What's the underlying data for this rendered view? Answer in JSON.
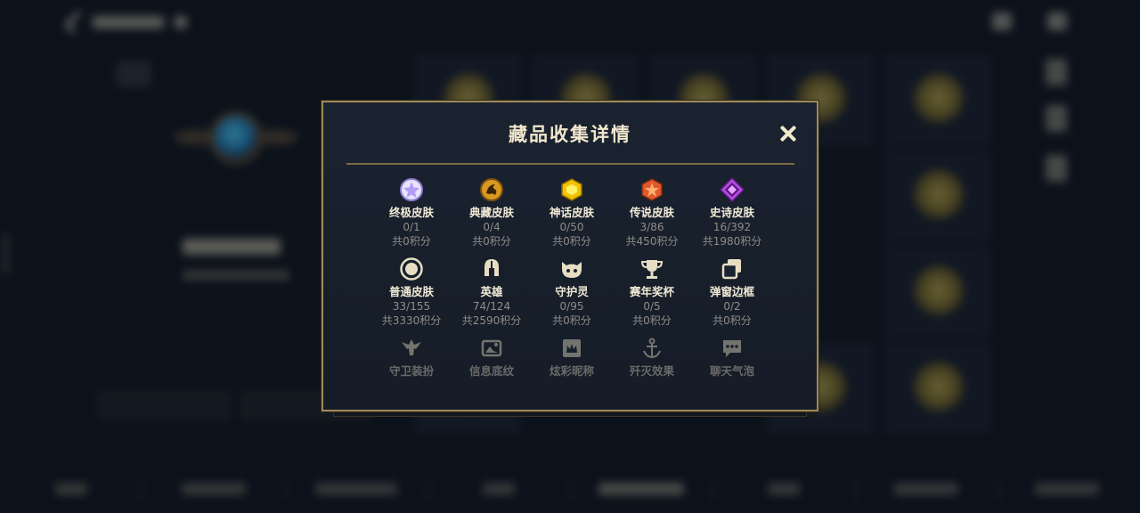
{
  "modal": {
    "title": "藏品收集详情",
    "close_label": "×"
  },
  "collections": [
    {
      "name": "终极皮肤",
      "count": "0/1",
      "score": "共0积分",
      "icon": "ultimate-skin-icon"
    },
    {
      "name": "典藏皮肤",
      "count": "0/4",
      "score": "共0积分",
      "icon": "collector-skin-icon"
    },
    {
      "name": "神话皮肤",
      "count": "0/50",
      "score": "共0积分",
      "icon": "mythic-skin-icon"
    },
    {
      "name": "传说皮肤",
      "count": "3/86",
      "score": "共450积分",
      "icon": "legend-skin-icon"
    },
    {
      "name": "史诗皮肤",
      "count": "16/392",
      "score": "共1980积分",
      "icon": "epic-skin-icon"
    },
    {
      "name": "普通皮肤",
      "count": "33/155",
      "score": "共3330积分",
      "icon": "common-skin-icon"
    },
    {
      "name": "英雄",
      "count": "74/124",
      "score": "共2590积分",
      "icon": "hero-helmet-icon"
    },
    {
      "name": "守护灵",
      "count": "0/95",
      "score": "共0积分",
      "icon": "guardian-spirit-icon"
    },
    {
      "name": "赛年奖杯",
      "count": "0/5",
      "score": "共0积分",
      "icon": "trophy-icon"
    },
    {
      "name": "弹窗边框",
      "count": "0/2",
      "score": "共0积分",
      "icon": "popup-frame-icon"
    },
    {
      "name": "守卫装扮",
      "icon": "ward-skin-icon"
    },
    {
      "name": "信息底纹",
      "icon": "info-background-icon"
    },
    {
      "name": "炫彩昵称",
      "icon": "colorful-nickname-icon"
    },
    {
      "name": "歼灭效果",
      "icon": "elimination-effect-icon"
    },
    {
      "name": "聊天气泡",
      "icon": "chat-bubble-icon"
    }
  ],
  "colors": {
    "modal_border": "#a08a58",
    "modal_bg": "#1a2330",
    "title": "#f0e7cc",
    "secondary_text": "#8f8d87"
  }
}
